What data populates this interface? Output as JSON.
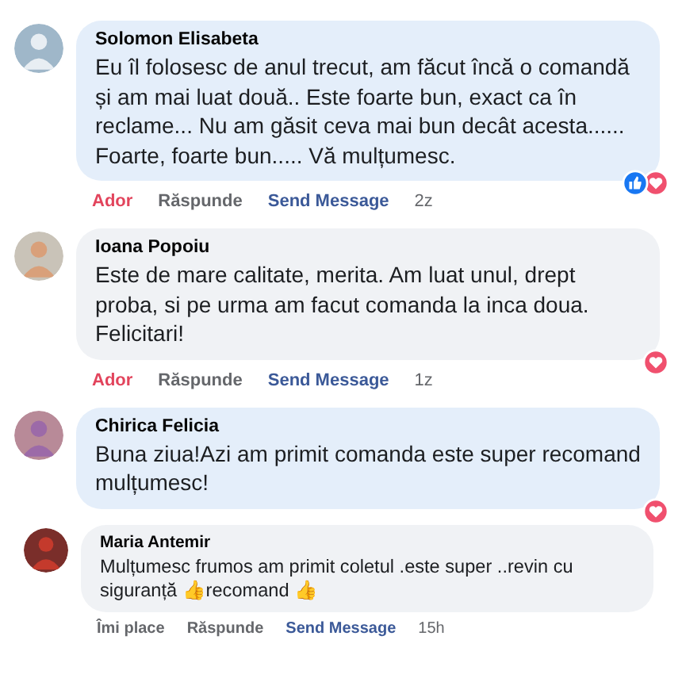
{
  "comments": [
    {
      "kind": "comment",
      "author": "Solomon Elisabeta",
      "text": "Eu îl folosesc de anul trecut, am făcut încă o comandă și am mai luat două.. Este foarte bun, exact ca în reclame... Nu am găsit ceva mai bun decât acesta...... Foarte, foarte bun..... Vă mulțumesc.",
      "color": "#e4eefa",
      "reactions": {
        "like": true,
        "love": true
      },
      "actions": {
        "react": "Ador",
        "reacted": true,
        "reply": "Răspunde",
        "message": "Send Message",
        "time": "2z"
      }
    },
    {
      "kind": "comment",
      "author": "Ioana Popoiu",
      "text": "Este de mare calitate, merita. Am luat unul, drept proba, si pe urma am facut comanda la inca doua. Felicitari!",
      "color": "#f0f2f5",
      "reactions": {
        "like": false,
        "love": true
      },
      "actions": {
        "react": "Ador",
        "reacted": true,
        "reply": "Răspunde",
        "message": "Send Message",
        "time": "1z"
      }
    },
    {
      "kind": "comment",
      "author": "Chirica Felicia",
      "text": "Buna ziua!Azi am primit comanda este super recomand mulțumesc!",
      "color": "#e4eefa",
      "reactions": {
        "like": false,
        "love": true
      }
    },
    {
      "kind": "reply",
      "author": "Maria Antemir",
      "text": "Mulțumesc frumos am primit coletul .este super ..revin cu siguranță 👍recomand 👍",
      "color": "#f0f2f5",
      "actions": {
        "react": "Îmi place",
        "reacted": false,
        "reply": "Răspunde",
        "message": "Send Message",
        "time": "15h"
      }
    }
  ]
}
